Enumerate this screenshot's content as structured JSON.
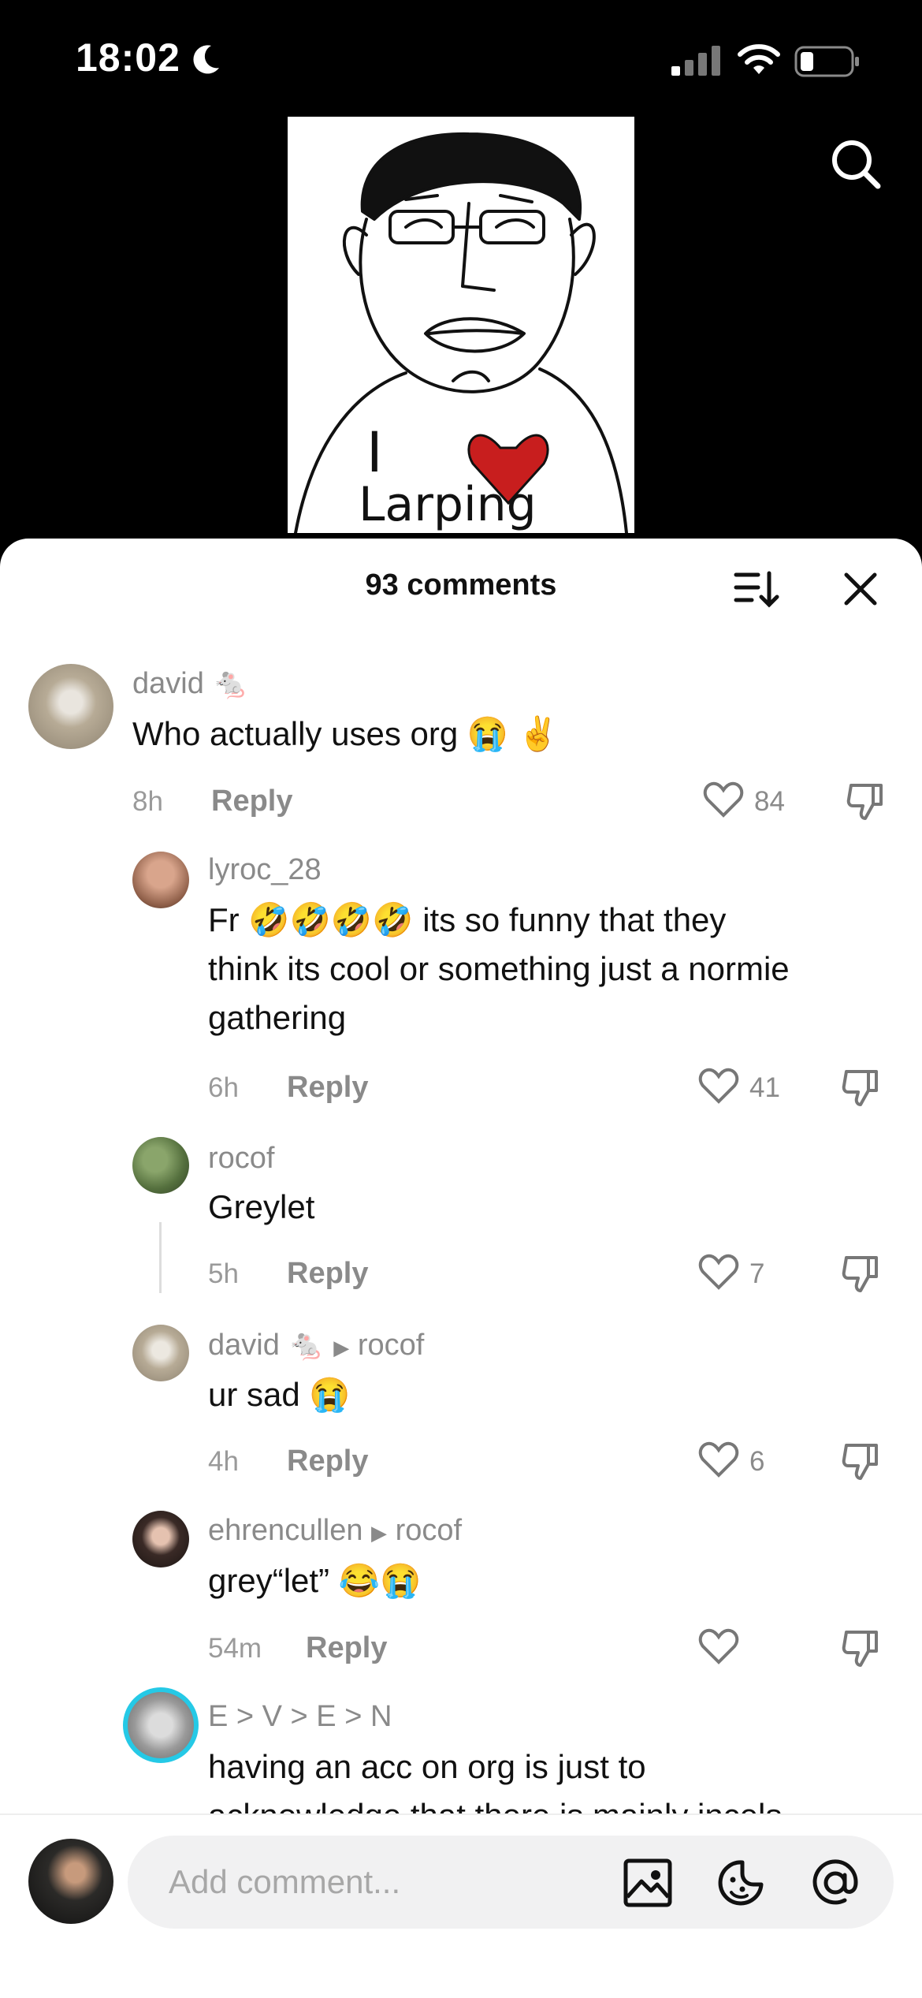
{
  "status_bar": {
    "time": "18:02"
  },
  "drawing": {
    "text_top": "I",
    "text_bottom": "Larping"
  },
  "sheet": {
    "title": "93 comments"
  },
  "comments": [
    {
      "user": "david",
      "text": "Who actually uses org",
      "emojis": "😭 ✌️",
      "time": "8h",
      "reply": "Reply",
      "likes": "84"
    },
    {
      "user": "lyroc_28",
      "text_lead": "Fr",
      "emojis": "🤣🤣🤣🤣",
      "text_line1_rest": "its so funny that they",
      "text_line2": "think its cool or something just a normie",
      "text_line3": "gathering",
      "time": "6h",
      "reply": "Reply",
      "likes": "41"
    },
    {
      "user": "rocof",
      "text": "Greylet",
      "time": "5h",
      "reply": "Reply",
      "likes": "7"
    },
    {
      "user": "david",
      "reply_to": "rocof",
      "text": "ur sad",
      "emojis": "😭",
      "time": "4h",
      "reply": "Reply",
      "likes": "6"
    },
    {
      "user": "ehrencullen",
      "reply_to": "rocof",
      "text": "grey“let”",
      "emojis": "😂😭",
      "time": "54m",
      "reply": "Reply",
      "likes": ""
    },
    {
      "user": "E > V > E > N",
      "text": "having an acc on org is just to",
      "text_line2": "acknowledge that there is mainly incels"
    }
  ],
  "input": {
    "placeholder": "Add comment..."
  },
  "colors": {
    "heart": "#c81e1e",
    "ring": "#25c9e6"
  },
  "icons": [
    "search-icon",
    "sort-icon",
    "close-icon",
    "heart-icon",
    "dislike-icon",
    "image-icon",
    "emoji-icon",
    "mention-icon",
    "rat-icon"
  ]
}
